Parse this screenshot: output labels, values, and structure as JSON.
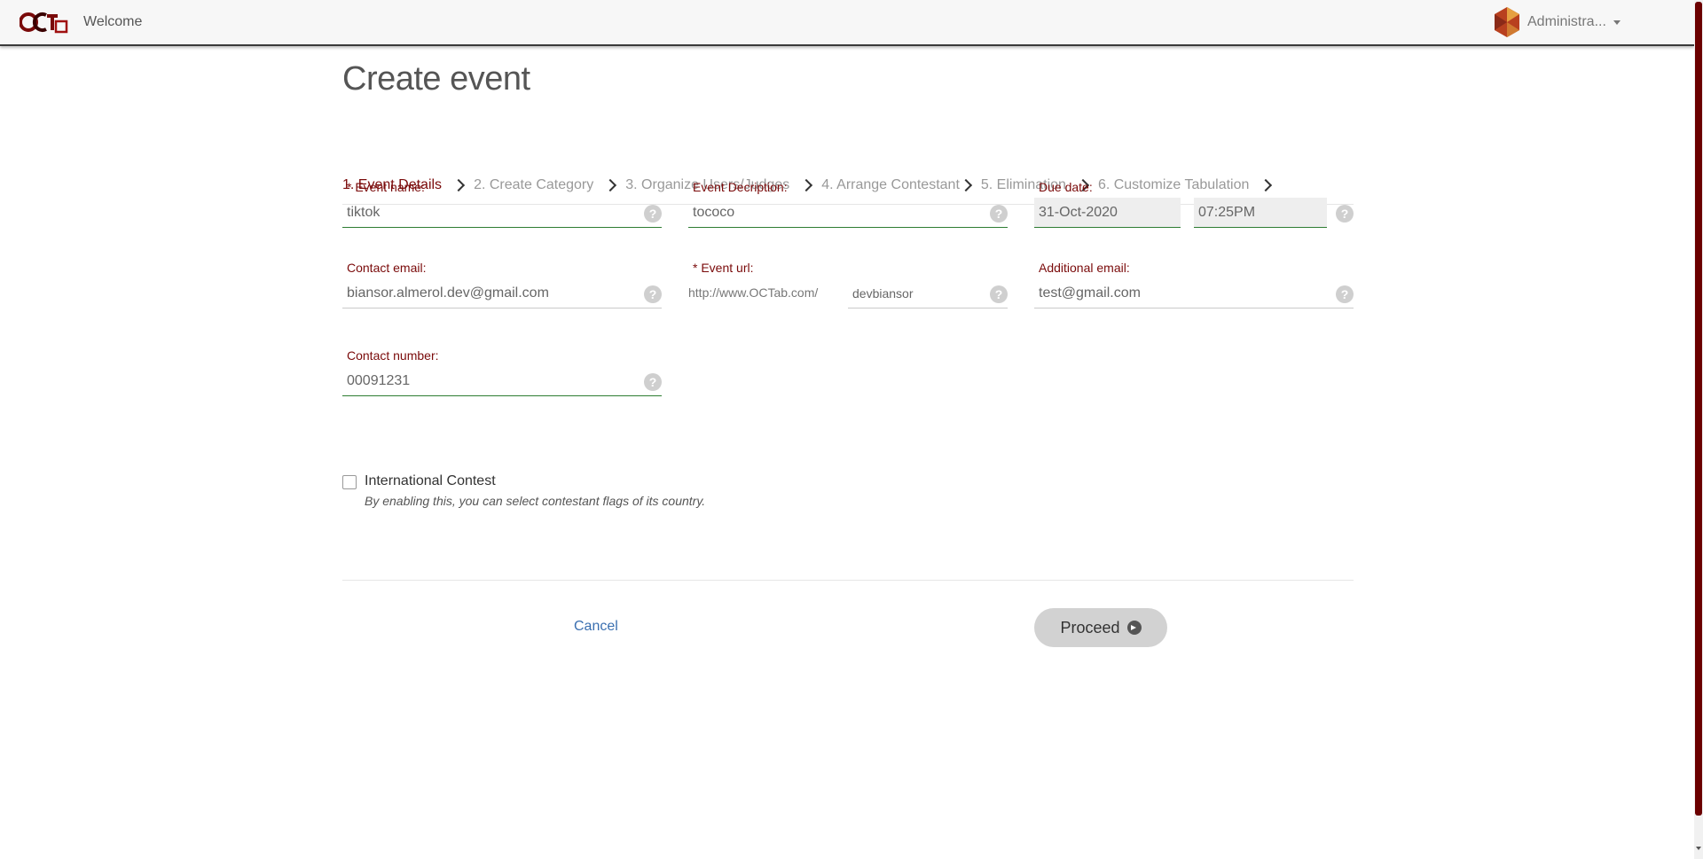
{
  "navbar": {
    "welcome": "Welcome",
    "user_name": "Administra..."
  },
  "page": {
    "title": "Create event"
  },
  "steps": [
    {
      "label": "1. Event Details"
    },
    {
      "label": "2. Create Category"
    },
    {
      "label": "3. Organize Users/Judges"
    },
    {
      "label": "4. Arrange Contestant"
    },
    {
      "label": "5. Elimination"
    },
    {
      "label": "6. Customize Tabulation"
    }
  ],
  "form": {
    "event_name": {
      "label": "* Event name:",
      "value": "tiktok"
    },
    "event_description": {
      "label": "Event Decription:",
      "value": "tococo"
    },
    "due_date": {
      "label": "Due date:",
      "date": "31-Oct-2020",
      "time": "07:25PM"
    },
    "contact_email": {
      "label": "Contact email:",
      "value": "biansor.almerol.dev@gmail.com"
    },
    "event_url": {
      "label": "* Event url:",
      "prefix": "http://www.OCTab.com/",
      "value": "devbiansor"
    },
    "additional_email": {
      "label": "Additional email:",
      "value": "test@gmail.com"
    },
    "contact_number": {
      "label": "Contact number:",
      "value": "00091231"
    },
    "help_glyph": "?"
  },
  "international": {
    "label": "International Contest",
    "note": "By enabling this, you can select contestant flags of its country.",
    "checked": false
  },
  "actions": {
    "cancel": "Cancel",
    "proceed": "Proceed"
  },
  "colors": {
    "accent": "#7a0a0a",
    "valid_underline": "#2e7d32",
    "link": "#3a6fb0"
  }
}
